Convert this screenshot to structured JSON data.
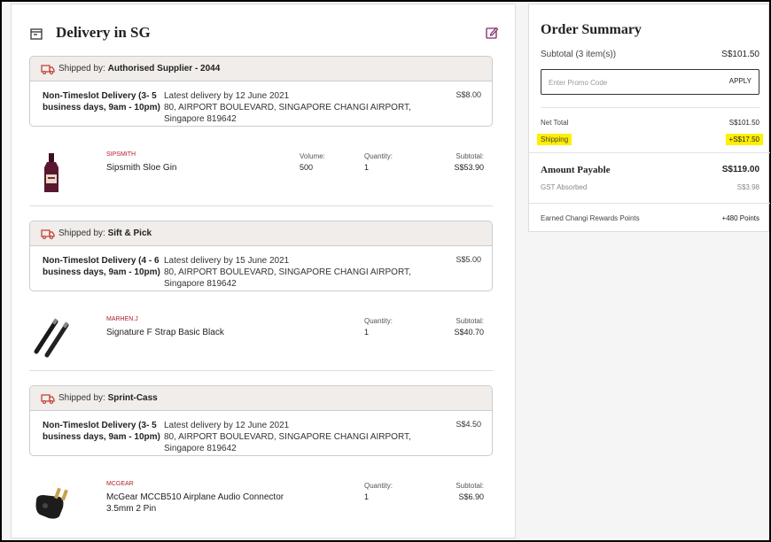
{
  "delivery": {
    "title": "Delivery in SG"
  },
  "shipments": [
    {
      "shipped_by_label": "Shipped by:",
      "supplier": "Authorised Supplier - 2044",
      "type_line1": "Non-Timeslot Delivery (3- 5",
      "type_line2": "business days, 9am - 10pm)",
      "latest": "Latest delivery by 12 June 2021",
      "addr1": "80, AIRPORT BOULEVARD, SINGAPORE CHANGI AIRPORT,",
      "addr2": "Singapore 819642",
      "price": "S$8.00",
      "product": {
        "brand": "SIPSMITH",
        "name": "Sipsmith Sloe Gin",
        "volume_label": "Volume:",
        "volume": "500",
        "quantity_label": "Quantity:",
        "quantity": "1",
        "subtotal_label": "Subtotal:",
        "subtotal": "S$53.90"
      }
    },
    {
      "shipped_by_label": "Shipped by:",
      "supplier": "Sift & Pick",
      "type_line1": "Non-Timeslot Delivery (4 - 6",
      "type_line2": "business days, 9am - 10pm)",
      "latest": "Latest delivery by 15 June 2021",
      "addr1": "80, AIRPORT BOULEVARD, SINGAPORE CHANGI AIRPORT,",
      "addr2": "Singapore 819642",
      "price": "S$5.00",
      "product": {
        "brand": "MARHEN.J",
        "name": "Signature F Strap Basic Black",
        "quantity_label": "Quantity:",
        "quantity": "1",
        "subtotal_label": "Subtotal:",
        "subtotal": "S$40.70"
      }
    },
    {
      "shipped_by_label": "Shipped by:",
      "supplier": "Sprint-Cass",
      "type_line1": "Non-Timeslot Delivery (3- 5",
      "type_line2": "business days, 9am - 10pm)",
      "latest": "Latest delivery by 12 June 2021",
      "addr1": "80, AIRPORT BOULEVARD, SINGAPORE CHANGI AIRPORT,",
      "addr2": "Singapore 819642",
      "price": "S$4.50",
      "product": {
        "brand": "MCGEAR",
        "name_line1": "McGear MCCB510 Airplane Audio Connector",
        "name_line2": "3.5mm 2 Pin",
        "quantity_label": "Quantity:",
        "quantity": "1",
        "subtotal_label": "Subtotal:",
        "subtotal": "S$6.90"
      }
    }
  ],
  "summary": {
    "title": "Order Summary",
    "subtotal_label": "Subtotal (3 item(s))",
    "subtotal": "S$101.50",
    "promo_placeholder": "Enter Promo Code",
    "apply_label": "APPLY",
    "net_total_label": "Net Total",
    "net_total": "S$101.50",
    "shipping_label": "Shipping",
    "shipping": "+S$17.50",
    "amount_payable_label": "Amount Payable",
    "amount_payable": "S$119.00",
    "gst_label": "GST Absorbed",
    "gst": "S$3.98",
    "points_label": "Earned Changi Rewards Points",
    "points": "+480 Points"
  },
  "colors": {
    "brand_red": "#b0202f",
    "highlight": "#ffef00",
    "edit_purple": "#7a2a6a"
  }
}
